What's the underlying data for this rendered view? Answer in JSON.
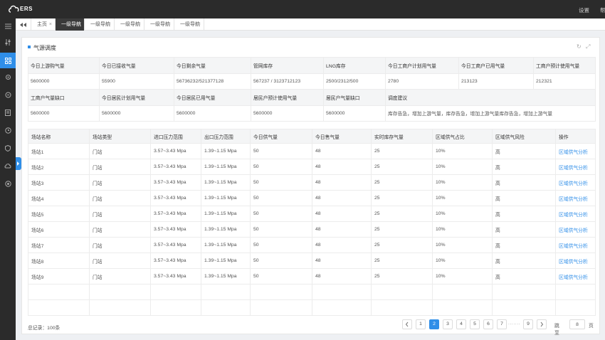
{
  "header": {
    "logo_text": "ERS",
    "settings_label": "设置",
    "user_label": "帮"
  },
  "sidebar": {
    "items": [
      {
        "icon": "menu-icon"
      },
      {
        "icon": "sliders-icon"
      },
      {
        "icon": "dashboard-icon",
        "active": true
      },
      {
        "icon": "gear-icon"
      },
      {
        "icon": "chat-icon"
      },
      {
        "icon": "document-icon"
      },
      {
        "icon": "clock-icon"
      },
      {
        "icon": "shield-icon"
      },
      {
        "icon": "cloud-icon"
      },
      {
        "icon": "globe-icon"
      }
    ]
  },
  "tabs": [
    {
      "label": "主页",
      "active": false
    },
    {
      "label": "一级导航",
      "active": true
    },
    {
      "label": "一级导航",
      "active": false
    },
    {
      "label": "一级导航",
      "active": false
    },
    {
      "label": "一级导航",
      "active": false
    },
    {
      "label": "一级导航",
      "active": false
    }
  ],
  "card": {
    "title": "气源调度"
  },
  "summary": {
    "row1_headers": [
      "今日上游购气量",
      "今日已接收气量",
      "今日剩余气量",
      "管网库存",
      "LNG库存",
      "今日工商户计划用气量",
      "今日工商户已用气量",
      "工商户预计使用气量"
    ],
    "row1_values": [
      "5600000",
      "55900",
      "56736232/521377128",
      "567237 / 3123712123",
      "2500/2312/500",
      "2780",
      "213123",
      "212321"
    ],
    "row2_headers": [
      "工商户气量缺口",
      "今日居民计划用气量",
      "今日居民已用气量",
      "居民户预计使用气量",
      "居民户气量缺口",
      "调度建议"
    ],
    "row2_values": [
      "5600000",
      "5600000",
      "5600000",
      "5600000",
      "5600000",
      "库存告急，增加上游气量，库存告急，增加上游气量库存告急，增加上游气量"
    ]
  },
  "stations": {
    "headers": [
      "场站名称",
      "场站类型",
      "进口压力范围",
      "出口压力范围",
      "今日供气量",
      "今日售气量",
      "实时库存气量",
      "区域供气占比",
      "区域供气风险",
      "操作"
    ],
    "rows": [
      [
        "场站1",
        "门站",
        "3.57~3.43 Mpa",
        "1.39~1.15 Mpa",
        "50",
        "48",
        "25",
        "10%",
        "高",
        "区域供气分析"
      ],
      [
        "场站2",
        "门站",
        "3.57~3.43 Mpa",
        "1.39~1.15 Mpa",
        "50",
        "48",
        "25",
        "10%",
        "高",
        "区域供气分析"
      ],
      [
        "场站3",
        "门站",
        "3.57~3.43 Mpa",
        "1.39~1.15 Mpa",
        "50",
        "48",
        "25",
        "10%",
        "高",
        "区域供气分析"
      ],
      [
        "场站4",
        "门站",
        "3.57~3.43 Mpa",
        "1.39~1.15 Mpa",
        "50",
        "48",
        "25",
        "10%",
        "高",
        "区域供气分析"
      ],
      [
        "场站5",
        "门站",
        "3.57~3.43 Mpa",
        "1.39~1.15 Mpa",
        "50",
        "48",
        "25",
        "10%",
        "高",
        "区域供气分析"
      ],
      [
        "场站6",
        "门站",
        "3.57~3.43 Mpa",
        "1.39~1.15 Mpa",
        "50",
        "48",
        "25",
        "10%",
        "高",
        "区域供气分析"
      ],
      [
        "场站7",
        "门站",
        "3.57~3.43 Mpa",
        "1.39~1.15 Mpa",
        "50",
        "48",
        "25",
        "10%",
        "高",
        "区域供气分析"
      ],
      [
        "场站8",
        "门站",
        "3.57~3.43 Mpa",
        "1.39~1.15 Mpa",
        "50",
        "48",
        "25",
        "10%",
        "高",
        "区域供气分析"
      ],
      [
        "场站9",
        "门站",
        "3.57~3.43 Mpa",
        "1.39~1.15 Mpa",
        "50",
        "48",
        "25",
        "10%",
        "高",
        "区域供气分析"
      ]
    ],
    "empty_rows": 2
  },
  "footer": {
    "total_label": "总记录：100条",
    "pages": [
      "1",
      "2",
      "3",
      "4",
      "5",
      "6",
      "7"
    ],
    "current_page": "2",
    "ellipsis": ".......",
    "last_page": "9",
    "jump_label": "跳至",
    "jump_value": "8",
    "page_unit": "页"
  },
  "colors": {
    "accent": "#2f8ee8",
    "topbar": "#2b2b2b",
    "active_tab": "#3a3a3a"
  }
}
